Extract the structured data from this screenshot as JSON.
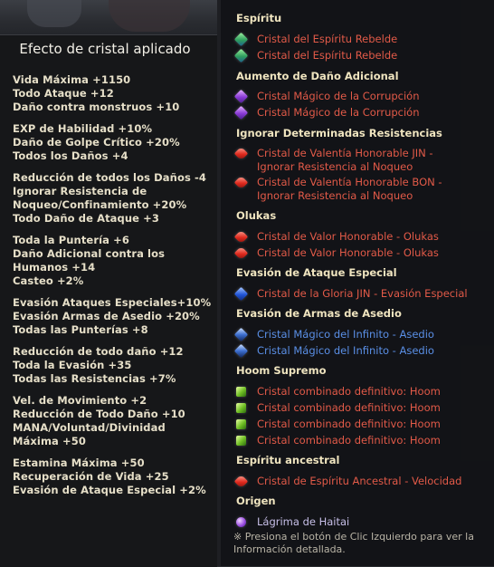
{
  "left_panel": {
    "title": "Efecto de cristal aplicado",
    "groups": [
      [
        "Vida Máxima +1150",
        "Todo Ataque +12",
        "Daño contra monstruos +10"
      ],
      [
        "EXP de Habilidad +10%",
        "Daño de Golpe Crítico +20%",
        "Todos los Daños +4"
      ],
      [
        "Reducción de todos los Daños -4",
        "Ignorar Resistencia de Noqueo/Confinamiento +20%",
        "Todo Daño de Ataque +3"
      ],
      [
        "Toda la Puntería +6",
        "Daño Adicional contra los Humanos +14",
        "Casteo +2%"
      ],
      [
        "Evasión Ataques Especiales+10%",
        "Evasión Armas de Asedio +20%",
        "Todas las Punterías +8"
      ],
      [
        "Reducción de todo daño +12",
        "Toda la Evasión +35",
        "Todas las Resistencias +7%"
      ],
      [
        "Vel. de Movimiento +2",
        "Reducción de Todo Daño +10",
        "MANA/Voluntad/Divinidad Máxima +50"
      ],
      [
        "Estamina Máxima +50",
        "Recuperación de Vida +25",
        "Evasión de Ataque Especial +2%"
      ]
    ]
  },
  "right_panel": {
    "sections": [
      {
        "title": "Espíritu",
        "items": [
          {
            "label": "Cristal del Espíritu Rebelde",
            "icon": "green-crystal-icon"
          },
          {
            "label": "Cristal del Espíritu Rebelde",
            "icon": "green-crystal-icon"
          }
        ]
      },
      {
        "title": "Aumento de Daño Adicional",
        "items": [
          {
            "label": "Cristal Mágico de la Corrupción",
            "icon": "purple-crystal-icon"
          },
          {
            "label": "Cristal Mágico de la Corrupción",
            "icon": "purple-crystal-icon"
          }
        ]
      },
      {
        "title": "Ignorar Determinadas Resistencias",
        "items": [
          {
            "label": "Cristal de Valentía Honorable JIN - Ignorar Resistencia al Noqueo",
            "icon": "red-crystal-icon"
          },
          {
            "label": "Cristal de Valentía Honorable BON - Ignorar Resistencia al Noqueo",
            "icon": "red-crystal-icon"
          }
        ]
      },
      {
        "title": "Olukas",
        "items": [
          {
            "label": "Cristal de Valor Honorable - Olukas",
            "icon": "red-crystal-icon"
          },
          {
            "label": "Cristal de Valor Honorable - Olukas",
            "icon": "red-crystal-icon"
          }
        ]
      },
      {
        "title": "Evasión de Ataque Especial",
        "items": [
          {
            "label": "Cristal de la Gloria JIN - Evasión Especial",
            "icon": "blue-crystal-icon"
          }
        ]
      },
      {
        "title": "Evasión de Armas de Asedio",
        "items": [
          {
            "label": "Cristal Mágico del Infinito - Asedio",
            "icon": "dark-blue-crystal-icon"
          },
          {
            "label": "Cristal Mágico del Infinito - Asedio",
            "icon": "dark-blue-crystal-icon"
          }
        ]
      },
      {
        "title": "Hoom Supremo",
        "items": [
          {
            "label": "Cristal combinado definitivo: Hoom",
            "icon": "lime-crystal-icon"
          },
          {
            "label": "Cristal combinado definitivo: Hoom",
            "icon": "lime-crystal-icon"
          },
          {
            "label": "Cristal combinado definitivo: Hoom",
            "icon": "lime-crystal-icon"
          },
          {
            "label": "Cristal combinado definitivo: Hoom",
            "icon": "lime-crystal-icon"
          }
        ]
      },
      {
        "title": "Espíritu ancestral",
        "items": [
          {
            "label": "Cristal de Espíritu Ancestral - Velocidad",
            "icon": "red-crystal-icon"
          }
        ]
      },
      {
        "title": "Origen",
        "items": [
          {
            "label": "Lágrima de Haitai",
            "icon": "violet-tear-icon"
          }
        ]
      }
    ],
    "note": "※ Presiona el botón de Clic Izquierdo para ver la Información detallada."
  },
  "colors": {
    "section_title": "#efe4bf",
    "item_red": "#e25a48",
    "item_blue": "#5a8fe6",
    "item_lavender": "#c7bfe8",
    "stat_text": "#e6dfc8"
  }
}
